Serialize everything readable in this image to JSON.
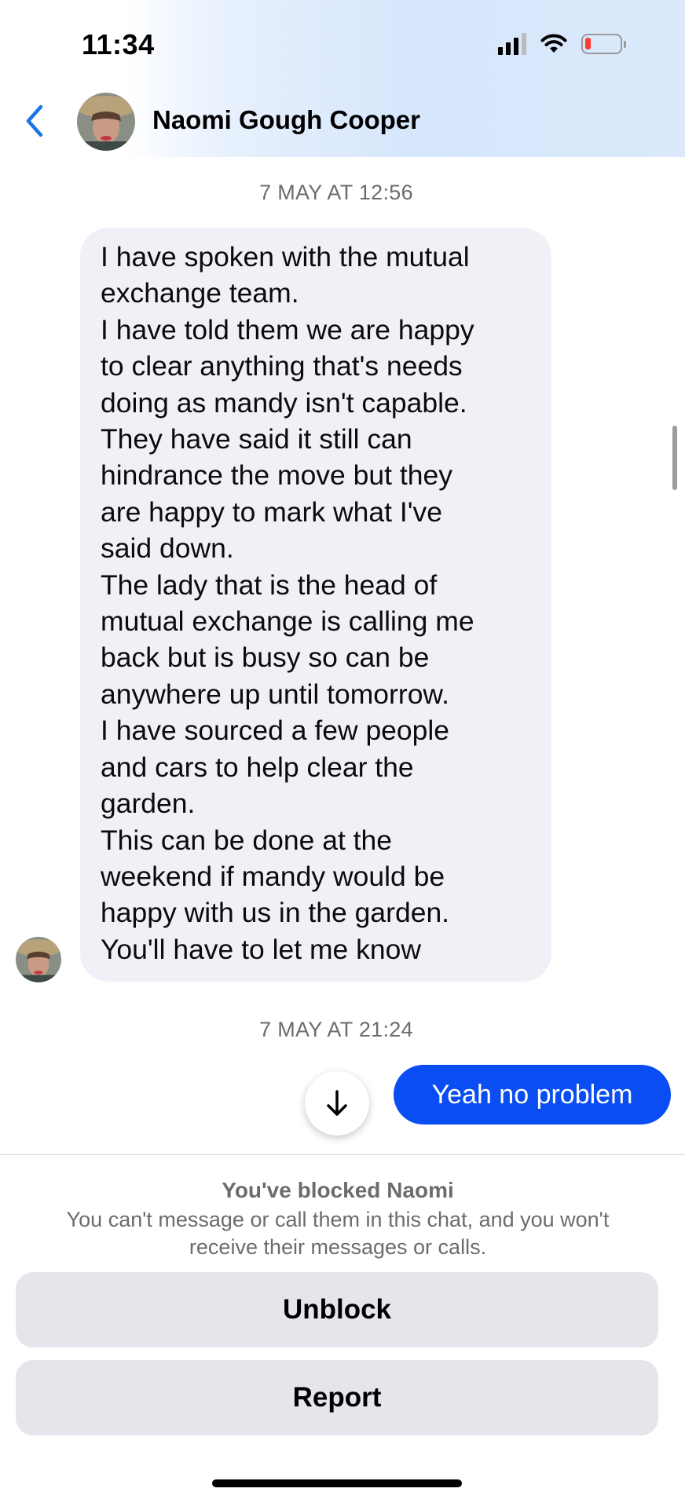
{
  "status_bar": {
    "time": "11:34",
    "battery_color": "#ff3b30"
  },
  "header": {
    "contact_name": "Naomi Gough Cooper",
    "back_icon": "chevron-left-icon",
    "accent": "#1a73e8"
  },
  "conversation": {
    "timestamp_1": "7 MAY AT 12:56",
    "incoming_message_lines": [
      "I have spoken with the mutual",
      "exchange team.",
      "I have told them we are happy",
      "to clear anything that's needs",
      "doing as mandy isn't  capable.",
      "They have said it still can",
      "hindrance the move but they",
      "are happy to mark what I've",
      "said down.",
      "The lady that is the head of",
      "mutual exchange is calling me",
      "back but is busy so can be",
      "anywhere up until tomorrow.",
      "I have sourced a few people",
      "and cars to help clear the",
      "garden.",
      "This can be done at the",
      "weekend if mandy would be",
      "happy with us in the garden.",
      "You'll have to let me know"
    ],
    "timestamp_2": "7 MAY AT 21:24",
    "outgoing_message": "Yeah no problem",
    "outgoing_color": "#0a4df2"
  },
  "blocked_notice": {
    "title": "You've blocked Naomi",
    "text": "You can't message or call them in this chat, and you won't receive their messages or calls."
  },
  "actions": {
    "unblock_label": "Unblock",
    "report_label": "Report"
  }
}
